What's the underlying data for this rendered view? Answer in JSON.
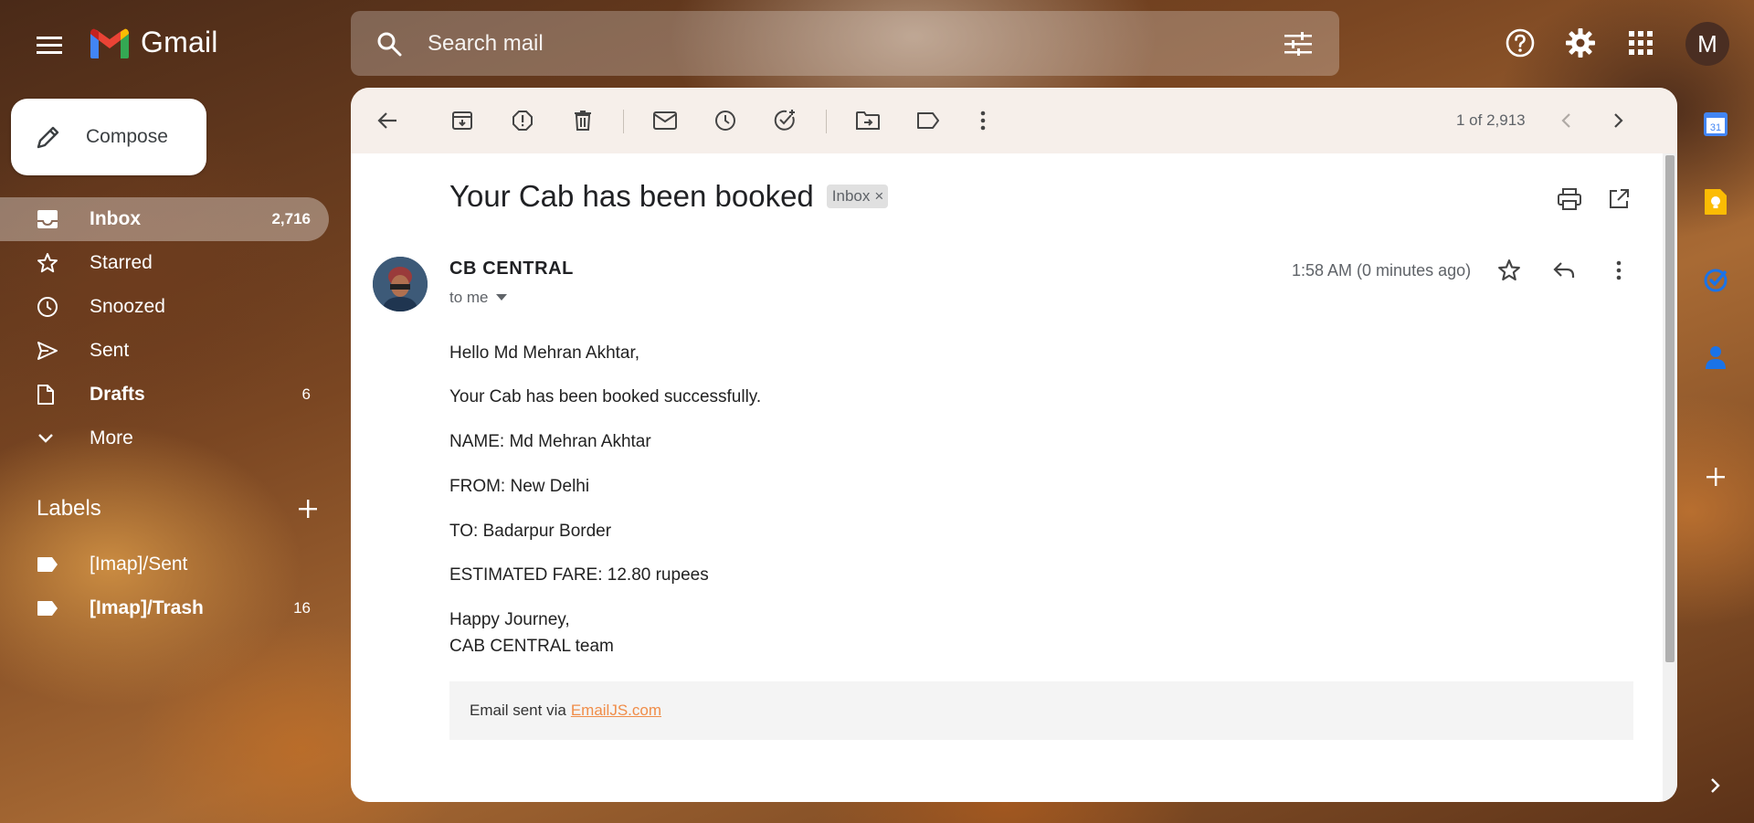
{
  "app": {
    "name": "Gmail"
  },
  "search": {
    "placeholder": "Search mail"
  },
  "profile": {
    "initial": "M"
  },
  "compose": {
    "label": "Compose"
  },
  "nav": [
    {
      "label": "Inbox",
      "count": "2,716"
    },
    {
      "label": "Starred",
      "count": ""
    },
    {
      "label": "Snoozed",
      "count": ""
    },
    {
      "label": "Sent",
      "count": ""
    },
    {
      "label": "Drafts",
      "count": "6"
    },
    {
      "label": "More",
      "count": ""
    }
  ],
  "labels": {
    "title": "Labels",
    "items": [
      {
        "label": "[Imap]/Sent",
        "count": ""
      },
      {
        "label": "[Imap]/Trash",
        "count": "16"
      }
    ]
  },
  "toolbar": {
    "pager": "1 of 2,913"
  },
  "email": {
    "subject": "Your Cab has been booked",
    "chip": "Inbox",
    "chip_close": "×",
    "sender": "CB CENTRAL",
    "to": "to me",
    "time": "1:58 AM (0 minutes ago)",
    "body": {
      "greeting": "Hello Md Mehran Akhtar,",
      "line1": "Your Cab has been booked successfully.",
      "name": "NAME: Md Mehran Akhtar",
      "from": "FROM: New Delhi",
      "to": "TO: Badarpur Border",
      "fare": "ESTIMATED FARE: 12.80 rupees",
      "signoff1": "Happy Journey,",
      "signoff2": "CAB CENTRAL team"
    },
    "footer": {
      "text": "Email sent via",
      "link": "EmailJS.com"
    }
  },
  "colors": {
    "gmail_red": "#ea4335",
    "gmail_blue": "#4285f4",
    "gmail_green": "#34a853",
    "gmail_yellow": "#fbbc04",
    "link_orange": "#f08d49"
  },
  "icons": {
    "topbar": [
      "menu-icon",
      "gmail-logo",
      "search-icon",
      "tune-icon",
      "help-icon",
      "settings-icon",
      "apps-icon"
    ],
    "toolbar": [
      "back-arrow-icon",
      "archive-icon",
      "report-spam-icon",
      "delete-icon",
      "mark-unread-icon",
      "snooze-icon",
      "add-task-icon",
      "move-to-icon",
      "label-icon",
      "more-vert-icon",
      "chevron-left-icon",
      "chevron-right-icon"
    ],
    "side_panel": [
      "calendar-icon",
      "keep-icon",
      "tasks-icon",
      "contacts-icon",
      "plus-icon",
      "chevron-right-icon"
    ]
  }
}
